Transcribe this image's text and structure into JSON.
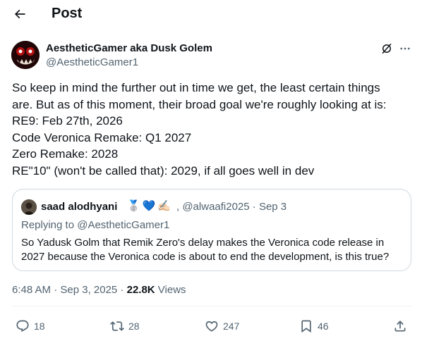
{
  "header": {
    "title": "Post"
  },
  "post": {
    "author_name": "AestheticGamer aka Dusk Golem",
    "author_handle": "@AestheticGamer1",
    "lines": [
      "So keep in mind the further out in time we get, the least certain things",
      "are. But as of this moment, their broad goal we're roughly looking at is:",
      "RE9: Feb 27th, 2026",
      "Code Veronica Remake: Q1 2027",
      "Zero Remake: 2028",
      "RE\"10\" (won't be called that): 2029, if all goes well in dev"
    ],
    "timestamp": "6:48 AM · Sep 3, 2025 · ",
    "views_count": "22.8K",
    "views_label": " Views"
  },
  "quote": {
    "author_name": "saad alodhyani",
    "emojis": [
      "🥈",
      "💙",
      "✍🏻"
    ],
    "meta": ", @alwaafi2025 · Sep 3",
    "replying_prefix": "Replying to ",
    "replying_handle": "@AestheticGamer1",
    "lines": [
      "So Yadusk Golm that Remik Zero's delay makes the Veronica code release in",
      "2027 because the Veronica code is about to end the development, is this true?"
    ]
  },
  "actions": {
    "replies": "18",
    "reposts": "28",
    "likes": "247",
    "bookmarks": "46"
  },
  "icons": {
    "back": "arrow-left-icon",
    "grok": "grok-icon",
    "more": "more-dots-icon",
    "reply": "reply-bubble-icon",
    "repost": "repost-icon",
    "like": "heart-icon",
    "bookmark": "bookmark-icon",
    "share": "share-icon"
  },
  "colors": {
    "text": "#0f1419",
    "secondary": "#536471",
    "border": "#cfd9de"
  }
}
